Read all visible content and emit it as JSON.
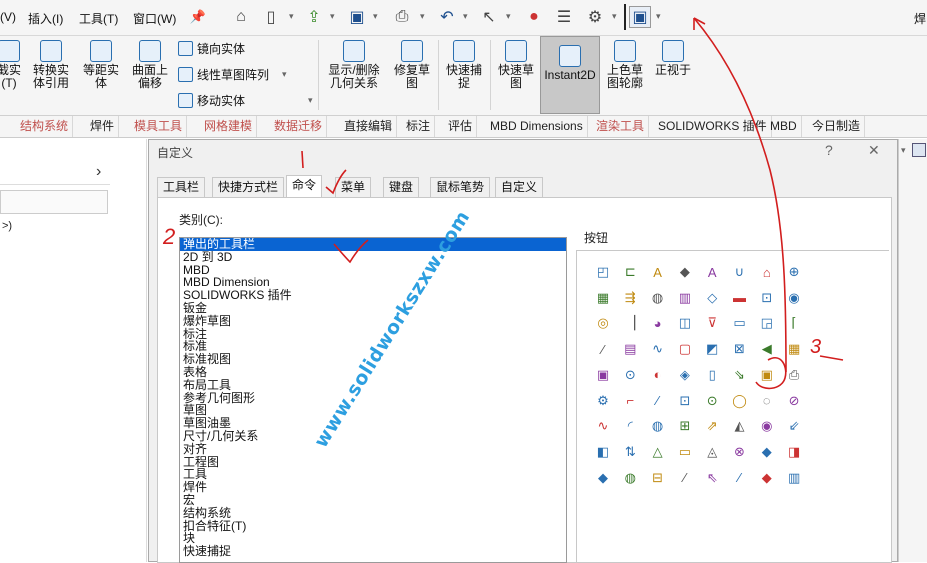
{
  "menubar": {
    "items": [
      "(V)",
      "插入(I)",
      "工具(T)",
      "窗口(W)"
    ],
    "right_text": "焊"
  },
  "ribbon": {
    "big_buttons": [
      "截实\n(T)",
      "转换实\n体引用",
      "等距实\n体",
      "曲面上\n偏移",
      "显示/删除\n几何关系",
      "修复草\n图",
      "快速捕\n捉",
      "快速草\n图",
      "Instant2D",
      "上色草\n图轮廓",
      "正视于"
    ],
    "small_buttons": [
      "镜向实体",
      "线性草图阵列",
      "移动实体"
    ]
  },
  "tabs": [
    {
      "label": "结构系统",
      "muted": true
    },
    {
      "label": "焊件",
      "muted": false
    },
    {
      "label": "模具工具",
      "muted": true
    },
    {
      "label": "网格建模",
      "muted": true
    },
    {
      "label": "数据迁移",
      "muted": true
    },
    {
      "label": "直接编辑",
      "muted": false
    },
    {
      "label": "标注",
      "muted": false
    },
    {
      "label": "评估",
      "muted": false
    },
    {
      "label": "MBD Dimensions",
      "muted": false
    },
    {
      "label": "渲染工具",
      "muted": true
    },
    {
      "label": "SOLIDWORKS 插件",
      "muted": false
    },
    {
      "label": "MBD",
      "muted": false
    },
    {
      "label": "今日制造",
      "muted": false
    }
  ],
  "left_panel": {
    "chevron": "›",
    "text": ">)"
  },
  "dialog": {
    "title": "自定义",
    "help": "?",
    "close": "✕",
    "tabs": [
      "工具栏",
      "快捷方式栏",
      "命令",
      "菜单",
      "键盘",
      "鼠标笔势",
      "自定义"
    ],
    "active_tab": "命令",
    "category_label": "类别(C):",
    "categories": [
      "弹出的工具栏",
      "2D 到 3D",
      "MBD",
      "MBD Dimension",
      "SOLIDWORKS 插件",
      "钣金",
      "爆炸草图",
      "标注",
      "标准",
      "标准视图",
      "表格",
      "布局工具",
      "参考几何图形",
      "草图",
      "草图油墨",
      "尺寸/几何关系",
      "对齐",
      "工程图",
      "工具",
      "焊件",
      "宏",
      "结构系统",
      "扣合特征(T)",
      "块",
      "快速捕捉"
    ],
    "buttons_label": "按钮"
  },
  "watermark": "www.solidworkszxw.com",
  "annotations": {
    "mark_1": "1",
    "mark_2": "2",
    "mark_3": "3"
  },
  "colors": {
    "selection": "#0a64d2",
    "annotation_red": "#d21e1e",
    "watermark": "#2d9fe0"
  }
}
